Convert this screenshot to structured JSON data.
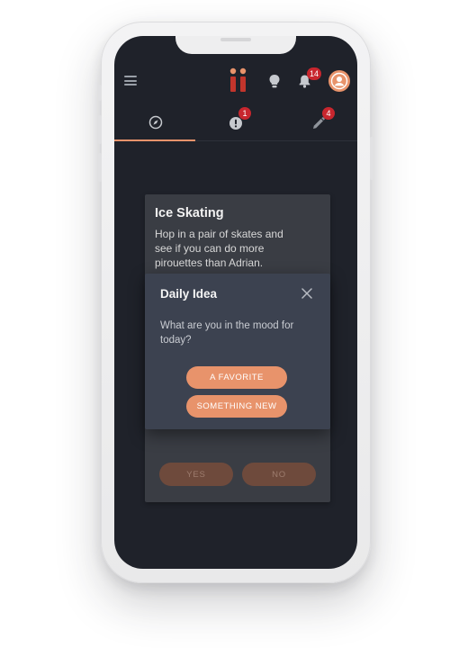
{
  "app": {
    "colors": {
      "accent": "#e8936b",
      "background": "#1f222a",
      "dialog": "#3c4250",
      "badge": "#c8262e"
    }
  },
  "header": {
    "menu_icon": "hamburger-menu-icon",
    "logo": "ii-logo",
    "idea_icon": "lightbulb-icon",
    "notifications_icon": "bell-icon",
    "notifications_badge": "14",
    "profile_icon": "avatar-person-icon"
  },
  "tabs": [
    {
      "icon": "compass-icon",
      "badge": "",
      "active": true
    },
    {
      "icon": "alert-circle-icon",
      "badge": "1",
      "active": false
    },
    {
      "icon": "pencil-icon",
      "badge": "4",
      "active": false
    }
  ],
  "idea_card": {
    "title": "Ice Skating",
    "description": "Hop in a pair of skates and see if you can do more pirouettes than Adrian.",
    "yes_label": "YES",
    "no_label": "NO"
  },
  "dialog": {
    "title": "Daily Idea",
    "message": "What are you in the mood for today?",
    "favorite_label": "A FAVORITE",
    "new_label": "SOMETHING NEW",
    "close_icon": "close-icon"
  }
}
